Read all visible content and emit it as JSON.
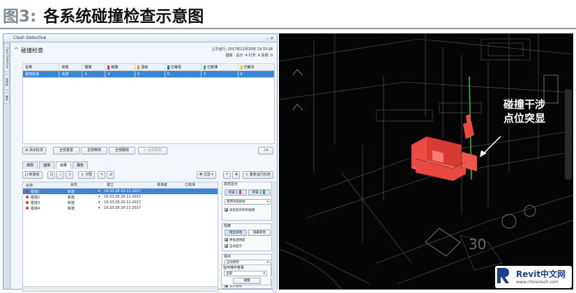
{
  "figure": {
    "number": "图3:",
    "title": "各系统碰撞检查示意图"
  },
  "window": {
    "title": "Clash Detective",
    "controls": "– ×",
    "side_tabs": [
      "Clash Detective",
      "选择树",
      "集合"
    ]
  },
  "header": {
    "title": "碰撞检查",
    "last_run": "上次运行: 2017年11月20日 19:33:28",
    "summary": "碰撞 - 总计: 4  打开: 4  关闭: 0"
  },
  "summary_table": {
    "columns": [
      {
        "label": "名称",
        "swatch": ""
      },
      {
        "label": "状态",
        "swatch": ""
      },
      {
        "label": "碰撞",
        "swatch": ""
      },
      {
        "label": "新建",
        "swatch": "#d93a2a"
      },
      {
        "label": "活动",
        "swatch": "#e39a2a"
      },
      {
        "label": "已审阅",
        "swatch": "#2a6fd6"
      },
      {
        "label": "已核准",
        "swatch": "#3bb34a"
      },
      {
        "label": "已解决",
        "swatch": "#e6c21e"
      }
    ],
    "rows": [
      [
        "碰撞检测",
        "完成",
        "4",
        "4",
        "0",
        "0",
        "0",
        "0"
      ]
    ]
  },
  "buttons": {
    "add_test": "添加检测",
    "reset_all": "全部重置",
    "compact_all": "全部精简",
    "delete_all": "全部删除",
    "update_all": "全部更新"
  },
  "tabs": [
    "规则",
    "选择",
    "结果",
    "报告"
  ],
  "toolbar": {
    "new_group": "新建组",
    "assign": "分配",
    "filter": "过滤",
    "refresh": "重新运行检测"
  },
  "results": {
    "columns": [
      "名称",
      "状态",
      "建立",
      "核准者",
      "已核准"
    ],
    "rows": [
      {
        "name": "碰撞1",
        "status": "新建",
        "date": "19:33:28 20-11-2017"
      },
      {
        "name": "碰撞2",
        "status": "新建",
        "date": "19:33:28 20-11-2017"
      },
      {
        "name": "碰撞3",
        "status": "新建",
        "date": "19:33:28 20-11-2017"
      },
      {
        "name": "碰撞4",
        "status": "新建",
        "date": "19:33:28 20-11-2017"
      }
    ]
  },
  "display_settings": {
    "highlight_title": "高亮显示",
    "item1": "项目 1",
    "item2": "项目 2",
    "highlight_mode": "使用项目颜色",
    "highlight_all": "高亮显示所有碰撞",
    "isolate_title": "隔离",
    "dim_other": "暗显其他",
    "hide_other": "隐藏其他",
    "reduce_transparency": "降低透明度",
    "auto_reveal": "自动显示",
    "viewpoint_title": "视点",
    "viewpoint_mode": "自动更新",
    "animate": "动画转场",
    "focus_clash": "关注碰撞",
    "simulation_title": "模拟",
    "show_simulation": "显示模拟",
    "view_in_env_title": "在环境中查看",
    "env_mode": "全部",
    "view_button": "视图"
  },
  "viewport": {
    "callout_line1": "碰撞干涉",
    "callout_line2": "点位突显",
    "marking": "30"
  },
  "logo": {
    "name": "Revit中文网",
    "url": "www.chinarevit.com"
  },
  "colors": {
    "clash_highlight": "#ef4b45",
    "selection": "#3d84d6",
    "axis_line": "#3fcf3f"
  }
}
